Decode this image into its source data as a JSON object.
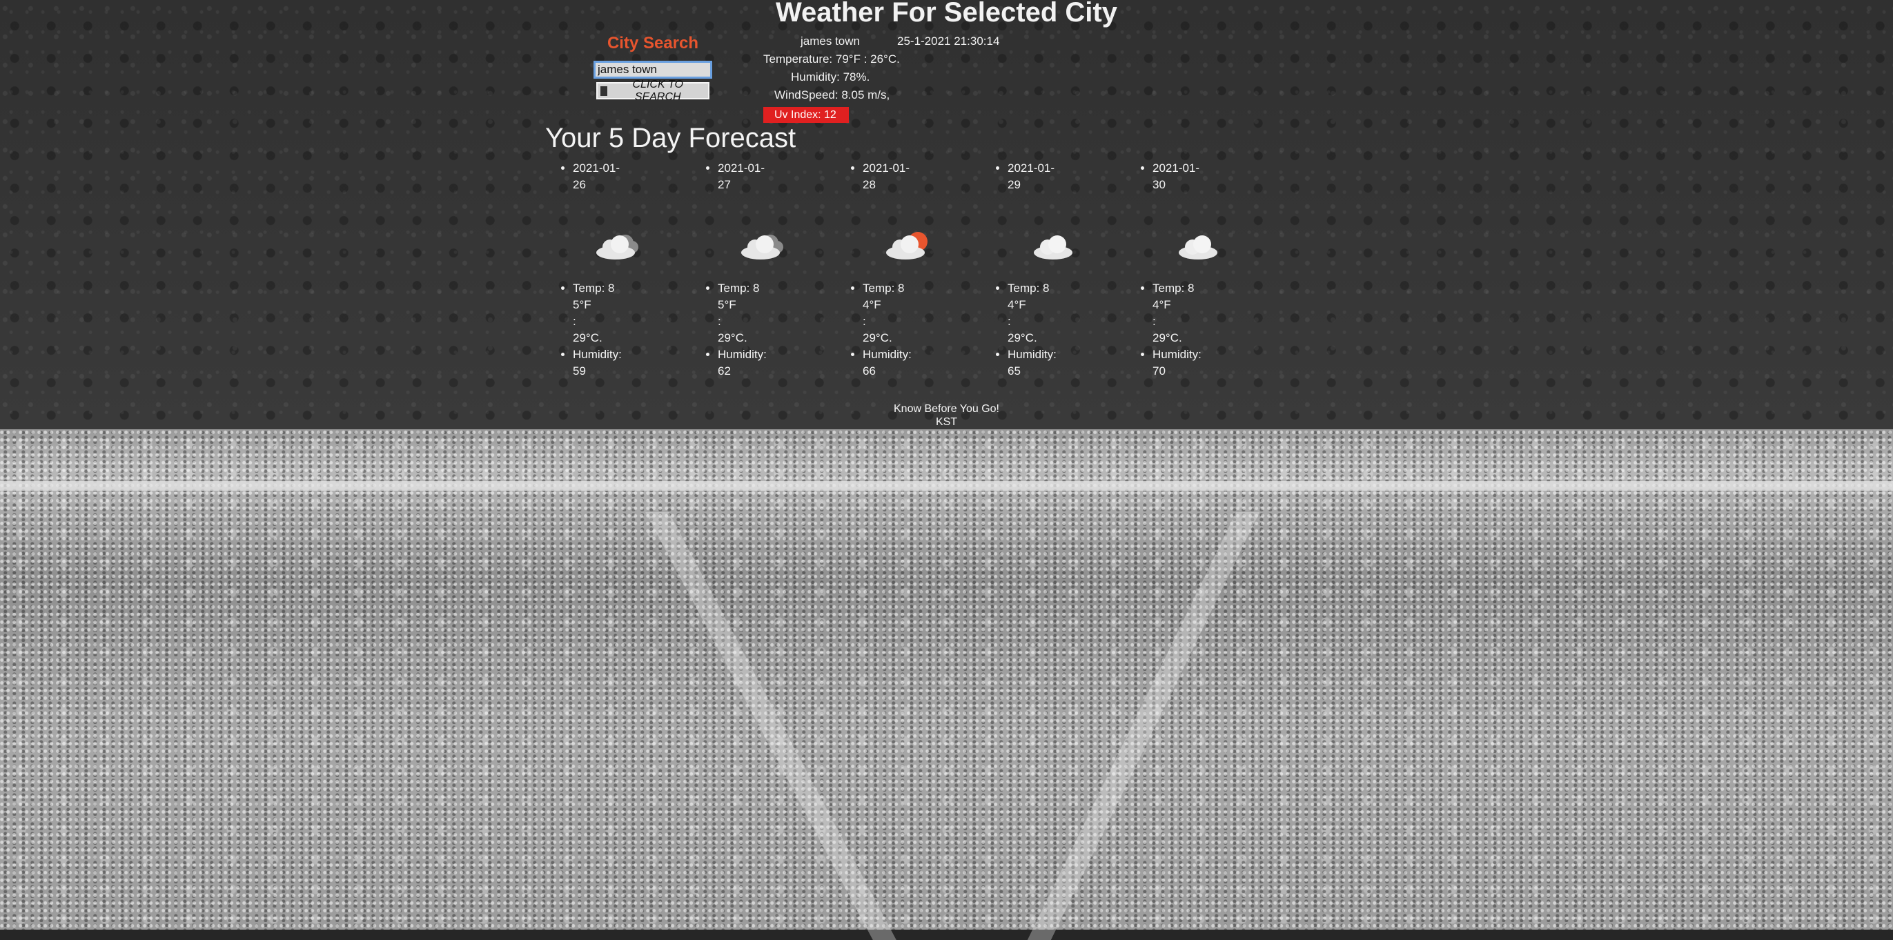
{
  "header": {
    "title": "Weather For Selected City"
  },
  "search": {
    "heading": "City Search",
    "input_value": "james town",
    "button_label": "CLICK TO SEARCH"
  },
  "current": {
    "city": "james town",
    "datetime": "25-1-2021 21:30:14",
    "temperature": "Temperature: 79°F : 26°C.",
    "humidity": "Humidity: 78%.",
    "windspeed": "WindSpeed: 8.05 m/s,",
    "uv_index": "Uv Index: 12",
    "uv_color": "#e02020"
  },
  "forecast": {
    "heading": "Your 5 Day Forecast",
    "days": [
      {
        "date": "2021-01-26",
        "icon": "cloudy-icon",
        "temp_f": "Temp: 85°F",
        "colon": ":",
        "temp_c": "29°C.",
        "humidity_label": "Humidity:",
        "humidity": "59"
      },
      {
        "date": "2021-01-27",
        "icon": "cloudy-icon",
        "temp_f": "Temp: 85°F",
        "colon": ":",
        "temp_c": "29°C.",
        "humidity_label": "Humidity:",
        "humidity": "62"
      },
      {
        "date": "2021-01-28",
        "icon": "partly-cloudy-sun-icon",
        "temp_f": "Temp: 84°F",
        "colon": ":",
        "temp_c": "29°C.",
        "humidity_label": "Humidity:",
        "humidity": "66"
      },
      {
        "date": "2021-01-29",
        "icon": "cloud-icon",
        "temp_f": "Temp: 84°F",
        "colon": ":",
        "temp_c": "29°C.",
        "humidity_label": "Humidity:",
        "humidity": "65"
      },
      {
        "date": "2021-01-30",
        "icon": "cloud-icon",
        "temp_f": "Temp: 84°F",
        "colon": ":",
        "temp_c": "29°C.",
        "humidity_label": "Humidity:",
        "humidity": "70"
      }
    ]
  },
  "footer": {
    "tagline": "Know Before You Go!",
    "credit": "KST"
  },
  "colors": {
    "accent": "#e8552e",
    "uv_badge": "#e02020"
  }
}
